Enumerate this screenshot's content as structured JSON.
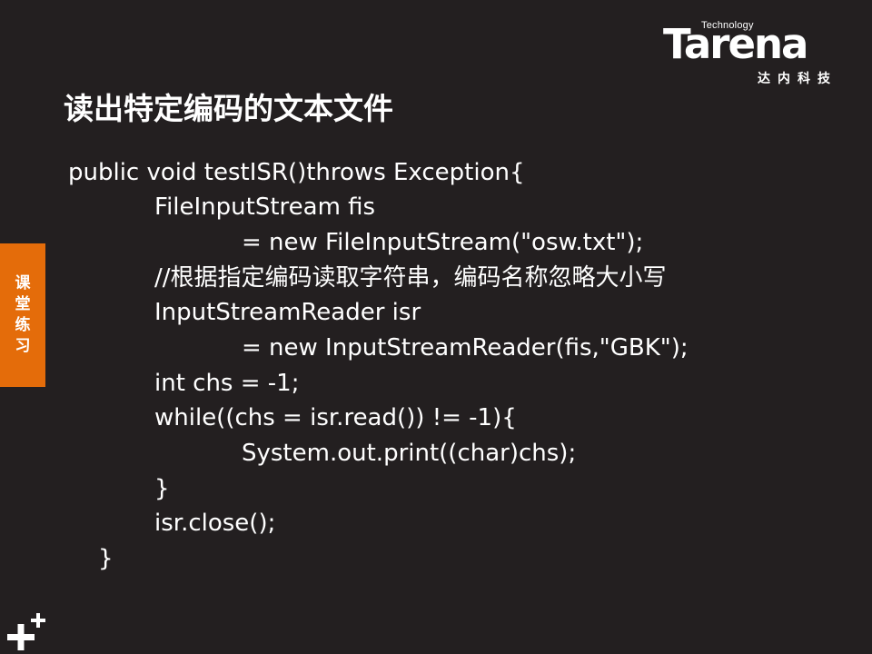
{
  "logo": {
    "technology": "Technology",
    "name": "Tarena",
    "subtitle": "达内科技"
  },
  "slide": {
    "title": "读出特定编码的文本文件"
  },
  "side_tab": {
    "chars": [
      "课",
      "堂",
      "练",
      "习"
    ]
  },
  "code": {
    "lines": [
      "public void testISR()throws Exception{",
      "FileInputStream fis",
      "= new FileInputStream(\"osw.txt\");",
      "//根据指定编码读取字符串，编码名称忽略大小写",
      "InputStreamReader isr",
      "= new InputStreamReader(fis,\"GBK\");",
      "int chs = -1;",
      "while((chs = isr.read()) != -1){",
      "System.out.print((char)chs);",
      "}",
      "isr.close();",
      "}"
    ]
  },
  "colors": {
    "background": "#231f20",
    "accent": "#e46c0a",
    "text": "#ffffff"
  },
  "icons": {
    "corner": "plus-plus-icon"
  }
}
